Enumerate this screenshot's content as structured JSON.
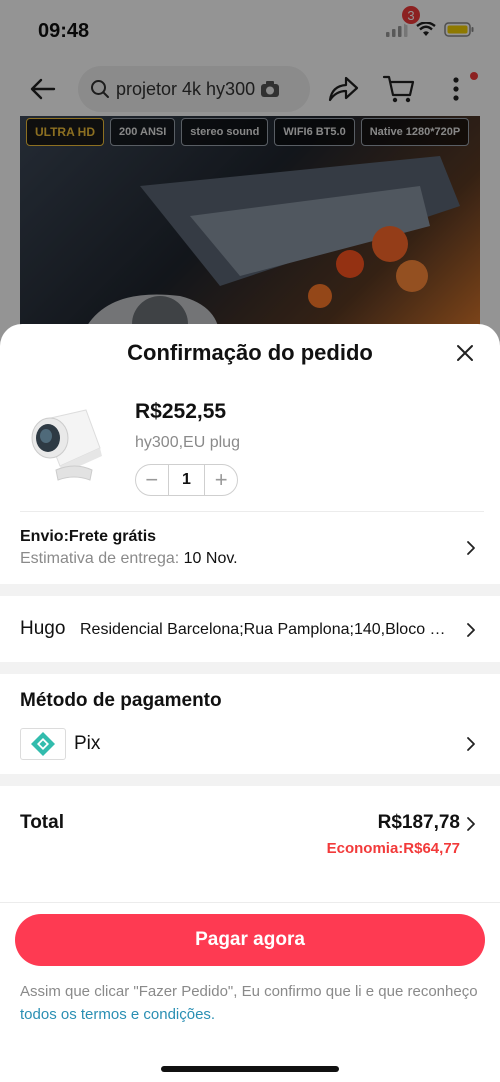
{
  "status_bar": {
    "time": "09:48"
  },
  "top_nav": {
    "search_query": "projetor 4k hy300",
    "cart_count": "3"
  },
  "hero": {
    "features": [
      "ULTRA HD",
      "200 ANSI",
      "stereo sound",
      "WIFI6 BT5.0",
      "Native 1280*720P"
    ]
  },
  "sheet": {
    "title": "Confirmação do pedido",
    "product": {
      "price": "R$252,55",
      "variant": "hy300,EU plug",
      "quantity": "1",
      "minus": "−",
      "plus": "+"
    },
    "shipping": {
      "title": "Envio:Frete grátis",
      "eta_label": "Estimativa de entrega: ",
      "eta_date": "10 Nov."
    },
    "address": {
      "name": "Hugo",
      "line": "Residencial Barcelona;Rua Pamplona;140,Bloco 3..."
    },
    "payment": {
      "title": "Método de pagamento",
      "method": "Pix"
    },
    "total": {
      "label": "Total",
      "amount": "R$187,78",
      "saving": "Economia:R$64,77"
    },
    "pay_button": "Pagar agora",
    "terms_text": "Assim que clicar \"Fazer Pedido\", Eu confirmo que li e que reconheço ",
    "terms_link": "todos os termos e condições."
  },
  "colors": {
    "primary_button": "#fe3a52",
    "saving_text": "#f23a3a",
    "link": "#2a8fb3",
    "pix": "#32bcad"
  }
}
